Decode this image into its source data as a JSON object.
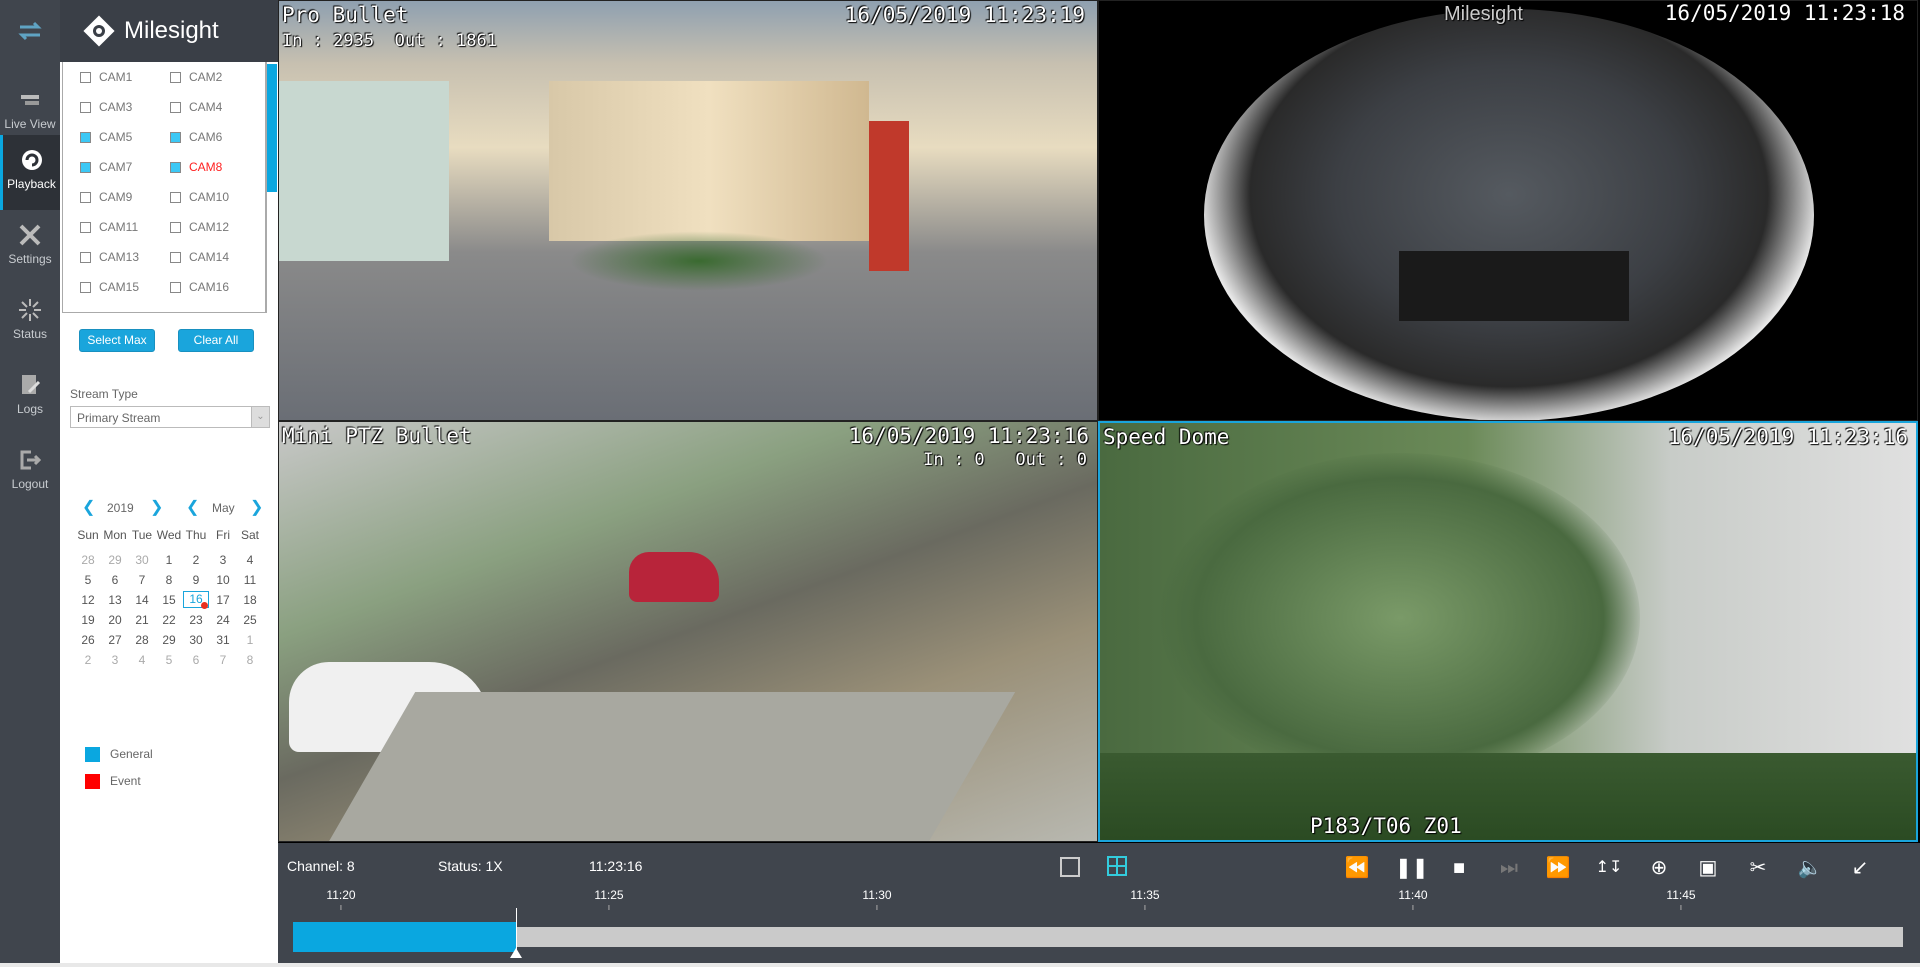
{
  "nav": {
    "items": [
      {
        "label": "",
        "icon": "swap-icon"
      },
      {
        "label": "Live View",
        "icon": "live-view-icon"
      },
      {
        "label": "Playback",
        "icon": "playback-icon",
        "active": true
      },
      {
        "label": "Settings",
        "icon": "settings-icon"
      },
      {
        "label": "Status",
        "icon": "status-icon"
      },
      {
        "label": "Logs",
        "icon": "logs-icon"
      },
      {
        "label": "Logout",
        "icon": "logout-icon"
      }
    ]
  },
  "brand": {
    "name": "Milesight"
  },
  "cameras": [
    {
      "label": "CAM1",
      "checked": false
    },
    {
      "label": "CAM2",
      "checked": false
    },
    {
      "label": "CAM3",
      "checked": false
    },
    {
      "label": "CAM4",
      "checked": false
    },
    {
      "label": "CAM5",
      "checked": true
    },
    {
      "label": "CAM6",
      "checked": true
    },
    {
      "label": "CAM7",
      "checked": true
    },
    {
      "label": "CAM8",
      "checked": true,
      "highlight": true
    },
    {
      "label": "CAM9",
      "checked": false
    },
    {
      "label": "CAM10",
      "checked": false
    },
    {
      "label": "CAM11",
      "checked": false
    },
    {
      "label": "CAM12",
      "checked": false
    },
    {
      "label": "CAM13",
      "checked": false
    },
    {
      "label": "CAM14",
      "checked": false
    },
    {
      "label": "CAM15",
      "checked": false
    },
    {
      "label": "CAM16",
      "checked": false
    }
  ],
  "buttons": {
    "select_max": "Select Max",
    "clear_all": "Clear All"
  },
  "stream": {
    "label": "Stream Type",
    "value": "Primary Stream"
  },
  "calendar": {
    "year": "2019",
    "month": "May",
    "weekdays": [
      "Sun",
      "Mon",
      "Tue",
      "Wed",
      "Thu",
      "Fri",
      "Sat"
    ],
    "days": [
      [
        "28",
        "29",
        "30",
        "1",
        "2",
        "3",
        "4"
      ],
      [
        "5",
        "6",
        "7",
        "8",
        "9",
        "10",
        "11"
      ],
      [
        "12",
        "13",
        "14",
        "15",
        "16",
        "17",
        "18"
      ],
      [
        "19",
        "20",
        "21",
        "22",
        "23",
        "24",
        "25"
      ],
      [
        "26",
        "27",
        "28",
        "29",
        "30",
        "31",
        "1"
      ],
      [
        "2",
        "3",
        "4",
        "5",
        "6",
        "7",
        "8"
      ]
    ],
    "selected": "16"
  },
  "legend": [
    {
      "label": "General",
      "color": "#0aa7e0"
    },
    {
      "label": "Event",
      "color": "#ff0000"
    }
  ],
  "tiles": [
    {
      "title": "Pro Bullet",
      "timestamp": "16/05/2019 11:23:19",
      "counter": "In : 2935  Out : 1861"
    },
    {
      "title": "",
      "watermark": "Milesight",
      "timestamp": "16/05/2019 11:23:18"
    },
    {
      "title": "Mini PTZ Bullet",
      "timestamp": "16/05/2019 11:23:16",
      "counter": "In : 0   Out : 0"
    },
    {
      "title": "Speed Dome",
      "timestamp": "16/05/2019 11:23:16",
      "ptz": "P183/T06 Z01",
      "selected": true
    }
  ],
  "playback": {
    "channel": "Channel: 8",
    "status": "Status: 1X",
    "time": "11:23:16",
    "ticks": [
      "11:20",
      "11:25",
      "11:30",
      "11:35",
      "11:40",
      "11:45"
    ],
    "recording": {
      "start": "11:19:06",
      "end": "11:23:16",
      "color": "#0aa7e0"
    },
    "controls": [
      "rewind-icon",
      "pause-icon",
      "stop-icon",
      "step-forward-icon",
      "fast-forward-icon",
      "smart-search-icon",
      "zoom-in-icon",
      "snapshot-icon",
      "clip-icon",
      "mute-icon",
      "exit-fullscreen-icon"
    ],
    "layouts": [
      "single-layout-icon",
      "quad-layout-icon"
    ]
  }
}
